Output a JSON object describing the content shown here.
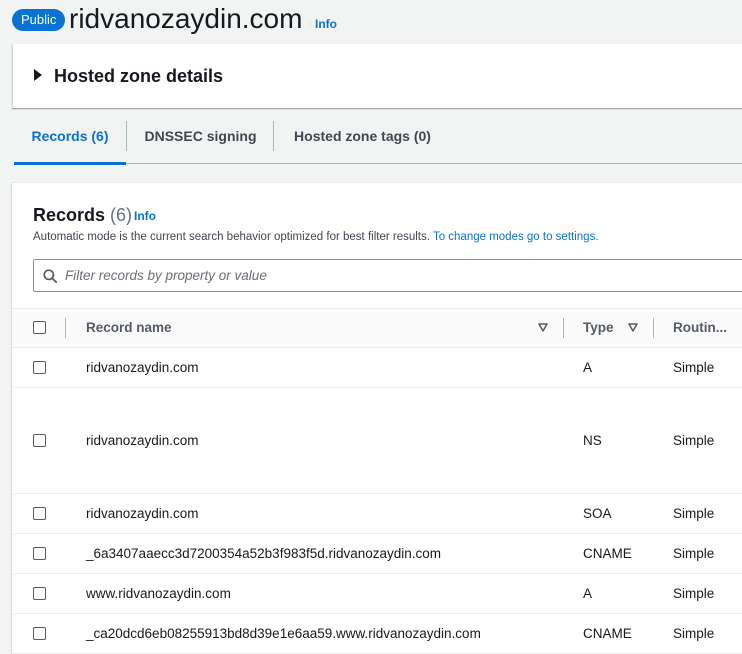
{
  "header": {
    "badge": "Public",
    "title": "ridvanozaydin.com",
    "info": "Info"
  },
  "details": {
    "title": "Hosted zone details"
  },
  "tabs": [
    {
      "label": "Records (6)",
      "active": true
    },
    {
      "label": "DNSSEC signing",
      "active": false
    },
    {
      "label": "Hosted zone tags (0)",
      "active": false
    }
  ],
  "records": {
    "heading": "Records",
    "count": "(6)",
    "info": "Info",
    "description": "Automatic mode is the current search behavior optimized for best filter results.",
    "settings_link": "To change modes go to settings.",
    "filter_placeholder": "Filter records by property or value",
    "columns": {
      "name": "Record name",
      "type": "Type",
      "routing": "Routin..."
    },
    "rows": [
      {
        "name": "ridvanozaydin.com",
        "type": "A",
        "routing": "Simple"
      },
      {
        "name": "ridvanozaydin.com",
        "type": "NS",
        "routing": "Simple"
      },
      {
        "name": "ridvanozaydin.com",
        "type": "SOA",
        "routing": "Simple"
      },
      {
        "name": "_6a3407aaecc3d7200354a52b3f983f5d.ridvanozaydin.com",
        "type": "CNAME",
        "routing": "Simple"
      },
      {
        "name": "www.ridvanozaydin.com",
        "type": "A",
        "routing": "Simple"
      },
      {
        "name": "_ca20dcd6eb08255913bd8d39e1e6aa59.www.ridvanozaydin.com",
        "type": "CNAME",
        "routing": "Simple"
      }
    ]
  },
  "colors": {
    "accent": "#0972d3",
    "text": "#16191f",
    "muted": "#545b64",
    "border": "#eaeded",
    "page_bg": "#f2f3f3"
  }
}
